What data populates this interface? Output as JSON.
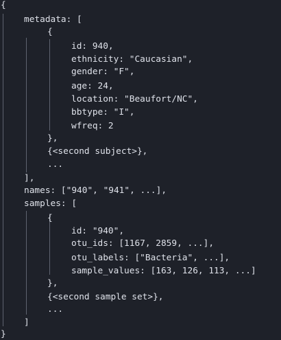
{
  "code": {
    "lines": [
      "{",
      "metadata: [",
      "{",
      "id: 940,",
      "ethnicity: \"Caucasian\",",
      "gender: \"F\",",
      "age: 24,",
      "location: \"Beaufort/NC\",",
      "bbtype: \"I\",",
      "wfreq: 2",
      "},",
      "{<second subject>},",
      "...",
      "],",
      "names: [\"940\", \"941\", ...],",
      "samples: [",
      "{",
      "id: \"940\",",
      "otu_ids: [1167, 2859, ...],",
      "otu_labels: [\"Bacteria\", ...],",
      "sample_values: [163, 126, 113, ...]",
      "},",
      "{<second sample set>},",
      "...",
      "]",
      "}"
    ]
  }
}
